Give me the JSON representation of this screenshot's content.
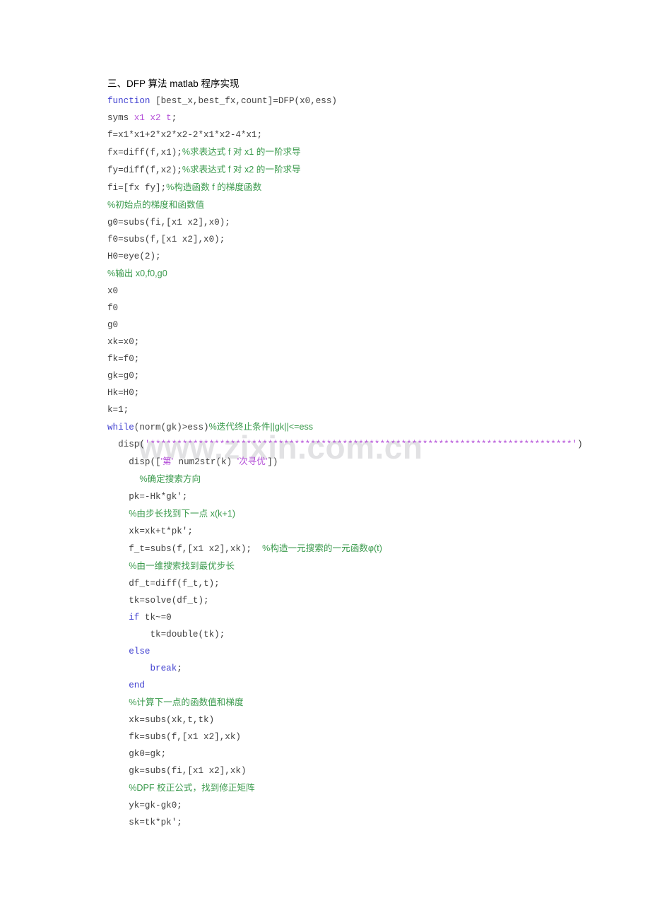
{
  "document": {
    "heading": "三、DFP 算法 matlab 程序实现",
    "watermark": "www.zixin.com.cn",
    "colors": {
      "keyword": "#4040d0",
      "comment": "#3a9a4c",
      "string": "#b44fd8",
      "plain": "#404040",
      "watermark": "#e2e2e4",
      "background": "#ffffff"
    },
    "code_lines": [
      {
        "id": 1,
        "indent": 0,
        "tokens": [
          {
            "t": "kw",
            "v": "function"
          },
          {
            "t": "pl",
            "v": " [best_x,best_fx,count]=DFP(x0,ess)"
          }
        ]
      },
      {
        "id": 2,
        "indent": 0,
        "tokens": [
          {
            "t": "pl",
            "v": "syms "
          },
          {
            "t": "sym",
            "v": "x1 x2 t"
          },
          {
            "t": "pl",
            "v": ";"
          }
        ]
      },
      {
        "id": 3,
        "indent": 0,
        "tokens": [
          {
            "t": "pl",
            "v": "f=x1*x1+2*x2*x2-2*x1*x2-4*x1;"
          }
        ]
      },
      {
        "id": 4,
        "indent": 0,
        "tokens": [
          {
            "t": "pl",
            "v": "fx=diff(f,x1);"
          },
          {
            "t": "cm",
            "v": "%求表达式 f 对 x1 的一阶求导"
          }
        ]
      },
      {
        "id": 5,
        "indent": 0,
        "tokens": [
          {
            "t": "pl",
            "v": "fy=diff(f,x2);"
          },
          {
            "t": "cm",
            "v": "%求表达式 f 对 x2 的一阶求导"
          }
        ]
      },
      {
        "id": 6,
        "indent": 0,
        "tokens": [
          {
            "t": "pl",
            "v": "fi=[fx fy];"
          },
          {
            "t": "cm",
            "v": "%构造函数 f 的梯度函数"
          }
        ]
      },
      {
        "id": 7,
        "indent": 0,
        "tokens": [
          {
            "t": "cm",
            "v": "%初始点的梯度和函数值"
          }
        ]
      },
      {
        "id": 8,
        "indent": 0,
        "tokens": [
          {
            "t": "pl",
            "v": "g0=subs(fi,[x1 x2],x0);"
          }
        ]
      },
      {
        "id": 9,
        "indent": 0,
        "tokens": [
          {
            "t": "pl",
            "v": "f0=subs(f,[x1 x2],x0);"
          }
        ]
      },
      {
        "id": 10,
        "indent": 0,
        "tokens": [
          {
            "t": "pl",
            "v": "H0=eye(2);"
          }
        ]
      },
      {
        "id": 11,
        "indent": 0,
        "tokens": [
          {
            "t": "cm",
            "v": "%输出 x0,f0,g0"
          }
        ]
      },
      {
        "id": 12,
        "indent": 0,
        "tokens": [
          {
            "t": "pl",
            "v": "x0"
          }
        ]
      },
      {
        "id": 13,
        "indent": 0,
        "tokens": [
          {
            "t": "pl",
            "v": "f0"
          }
        ]
      },
      {
        "id": 14,
        "indent": 0,
        "tokens": [
          {
            "t": "pl",
            "v": "g0"
          }
        ]
      },
      {
        "id": 15,
        "indent": 0,
        "tokens": [
          {
            "t": "pl",
            "v": "xk=x0;"
          }
        ]
      },
      {
        "id": 16,
        "indent": 0,
        "tokens": [
          {
            "t": "pl",
            "v": "fk=f0;"
          }
        ]
      },
      {
        "id": 17,
        "indent": 0,
        "tokens": [
          {
            "t": "pl",
            "v": "gk=g0;"
          }
        ]
      },
      {
        "id": 18,
        "indent": 0,
        "tokens": [
          {
            "t": "pl",
            "v": "Hk=H0;"
          }
        ]
      },
      {
        "id": 19,
        "indent": 0,
        "tokens": [
          {
            "t": "pl",
            "v": "k=1;"
          }
        ]
      },
      {
        "id": 20,
        "indent": 0,
        "tokens": [
          {
            "t": "kw",
            "v": "while"
          },
          {
            "t": "pl",
            "v": "(norm(gk)>ess)"
          },
          {
            "t": "cm",
            "v": "%迭代终止条件||gk||<=ess"
          }
        ]
      },
      {
        "id": 21,
        "indent": 1,
        "tokens": [
          {
            "t": "pl",
            "v": "disp("
          },
          {
            "t": "str",
            "v": "'*******************************************************************************'"
          },
          {
            "t": "pl",
            "v": ")"
          }
        ]
      },
      {
        "id": 22,
        "indent": 2,
        "tokens": [
          {
            "t": "pl",
            "v": "disp(["
          },
          {
            "t": "str",
            "v": "'第'"
          },
          {
            "t": "pl",
            "v": " num2str(k) "
          },
          {
            "t": "str",
            "v": "'次寻优'"
          },
          {
            "t": "pl",
            "v": "])"
          }
        ]
      },
      {
        "id": 23,
        "indent": 3,
        "tokens": [
          {
            "t": "cm",
            "v": "%确定搜索方向"
          }
        ]
      },
      {
        "id": 24,
        "indent": 2,
        "tokens": [
          {
            "t": "pl",
            "v": "pk=-Hk*gk';"
          }
        ]
      },
      {
        "id": 25,
        "indent": 2,
        "tokens": [
          {
            "t": "cm",
            "v": "%由步长找到下一点 x(k+1)"
          }
        ]
      },
      {
        "id": 26,
        "indent": 2,
        "tokens": [
          {
            "t": "pl",
            "v": "xk=xk+t*pk';"
          }
        ]
      },
      {
        "id": 27,
        "indent": 2,
        "tokens": [
          {
            "t": "pl",
            "v": "f_t=subs(f,[x1 x2],xk);  "
          },
          {
            "t": "cm",
            "v": "%构造一元搜索的一元函数φ(t)"
          }
        ]
      },
      {
        "id": 28,
        "indent": 2,
        "tokens": [
          {
            "t": "cm",
            "v": "%由一维搜索找到最优步长"
          }
        ]
      },
      {
        "id": 29,
        "indent": 2,
        "tokens": [
          {
            "t": "pl",
            "v": "df_t=diff(f_t,t);"
          }
        ]
      },
      {
        "id": 30,
        "indent": 2,
        "tokens": [
          {
            "t": "pl",
            "v": "tk=solve(df_t);"
          }
        ]
      },
      {
        "id": 31,
        "indent": 2,
        "tokens": [
          {
            "t": "kw",
            "v": "if"
          },
          {
            "t": "pl",
            "v": " tk~=0"
          }
        ]
      },
      {
        "id": 32,
        "indent": 4,
        "tokens": [
          {
            "t": "pl",
            "v": "tk=double(tk);"
          }
        ]
      },
      {
        "id": 33,
        "indent": 2,
        "tokens": [
          {
            "t": "kw",
            "v": "else"
          }
        ]
      },
      {
        "id": 34,
        "indent": 4,
        "tokens": [
          {
            "t": "kw",
            "v": "break"
          },
          {
            "t": "pl",
            "v": ";"
          }
        ]
      },
      {
        "id": 35,
        "indent": 2,
        "tokens": [
          {
            "t": "kw",
            "v": "end"
          }
        ]
      },
      {
        "id": 36,
        "indent": 2,
        "tokens": [
          {
            "t": "cm",
            "v": "%计算下一点的函数值和梯度"
          }
        ]
      },
      {
        "id": 37,
        "indent": 2,
        "tokens": [
          {
            "t": "pl",
            "v": "xk=subs(xk,t,tk)"
          }
        ]
      },
      {
        "id": 38,
        "indent": 2,
        "tokens": [
          {
            "t": "pl",
            "v": "fk=subs(f,[x1 x2],xk)"
          }
        ]
      },
      {
        "id": 39,
        "indent": 2,
        "tokens": [
          {
            "t": "pl",
            "v": "gk0=gk;"
          }
        ]
      },
      {
        "id": 40,
        "indent": 2,
        "tokens": [
          {
            "t": "pl",
            "v": "gk=subs(fi,[x1 x2],xk)"
          }
        ]
      },
      {
        "id": 41,
        "indent": 2,
        "tokens": [
          {
            "t": "cm",
            "v": "%DPF 校正公式，找到修正矩阵"
          }
        ]
      },
      {
        "id": 42,
        "indent": 2,
        "tokens": [
          {
            "t": "pl",
            "v": "yk=gk-gk0;"
          }
        ]
      },
      {
        "id": 43,
        "indent": 2,
        "tokens": [
          {
            "t": "pl",
            "v": "sk=tk*pk';"
          }
        ]
      }
    ]
  }
}
